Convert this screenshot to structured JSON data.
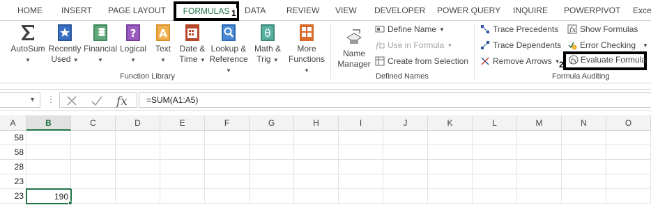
{
  "tabs": [
    {
      "label": "HOME"
    },
    {
      "label": "INSERT"
    },
    {
      "label": "PAGE LAYOUT"
    },
    {
      "label": "FORMULAS"
    },
    {
      "label": "DATA"
    },
    {
      "label": "REVIEW"
    },
    {
      "label": "VIEW"
    },
    {
      "label": "DEVELOPER"
    },
    {
      "label": "POWER QUERY"
    },
    {
      "label": "INQUIRE"
    },
    {
      "label": "POWERPIVOT"
    },
    {
      "label": "Exce"
    }
  ],
  "markers": {
    "one": "1",
    "two": "2"
  },
  "function_library": {
    "group_label": "Function Library",
    "autosum": {
      "line1": "AutoSum",
      "line2": ""
    },
    "recently_used": {
      "line1": "Recently",
      "line2": "Used"
    },
    "financial": {
      "line1": "Financial",
      "line2": ""
    },
    "logical": {
      "line1": "Logical",
      "line2": ""
    },
    "text": {
      "line1": "Text",
      "line2": ""
    },
    "date_time": {
      "line1": "Date &",
      "line2": "Time"
    },
    "lookup_reference": {
      "line1": "Lookup &",
      "line2": "Reference"
    },
    "math_trig": {
      "line1": "Math &",
      "line2": "Trig"
    },
    "more_functions": {
      "line1": "More",
      "line2": "Functions"
    }
  },
  "defined_names": {
    "group_label": "Defined Names",
    "name_manager": {
      "line1": "Name",
      "line2": "Manager"
    },
    "define_name": "Define Name",
    "use_in_formula": "Use in Formula",
    "create_from_selection": "Create from Selection"
  },
  "formula_auditing": {
    "group_label": "Formula Auditing",
    "trace_precedents": "Trace Precedents",
    "trace_dependents": "Trace Dependents",
    "remove_arrows": "Remove Arrows",
    "show_formulas": "Show Formulas",
    "error_checking": "Error Checking",
    "evaluate_formula": "Evaluate Formula"
  },
  "formula_bar": {
    "name_box": "",
    "formula": "=SUM(A1:A5)"
  },
  "grid": {
    "columns": [
      "A",
      "B",
      "C",
      "D",
      "E",
      "F",
      "G",
      "H",
      "I",
      "J",
      "K",
      "L",
      "M",
      "N",
      "O"
    ],
    "selected_column": "B",
    "column_a_values": [
      "58",
      "58",
      "28",
      "23",
      "23"
    ],
    "selected_cell_value": "190"
  },
  "colors": {
    "accent": "#217346",
    "annotation": "#000000"
  }
}
